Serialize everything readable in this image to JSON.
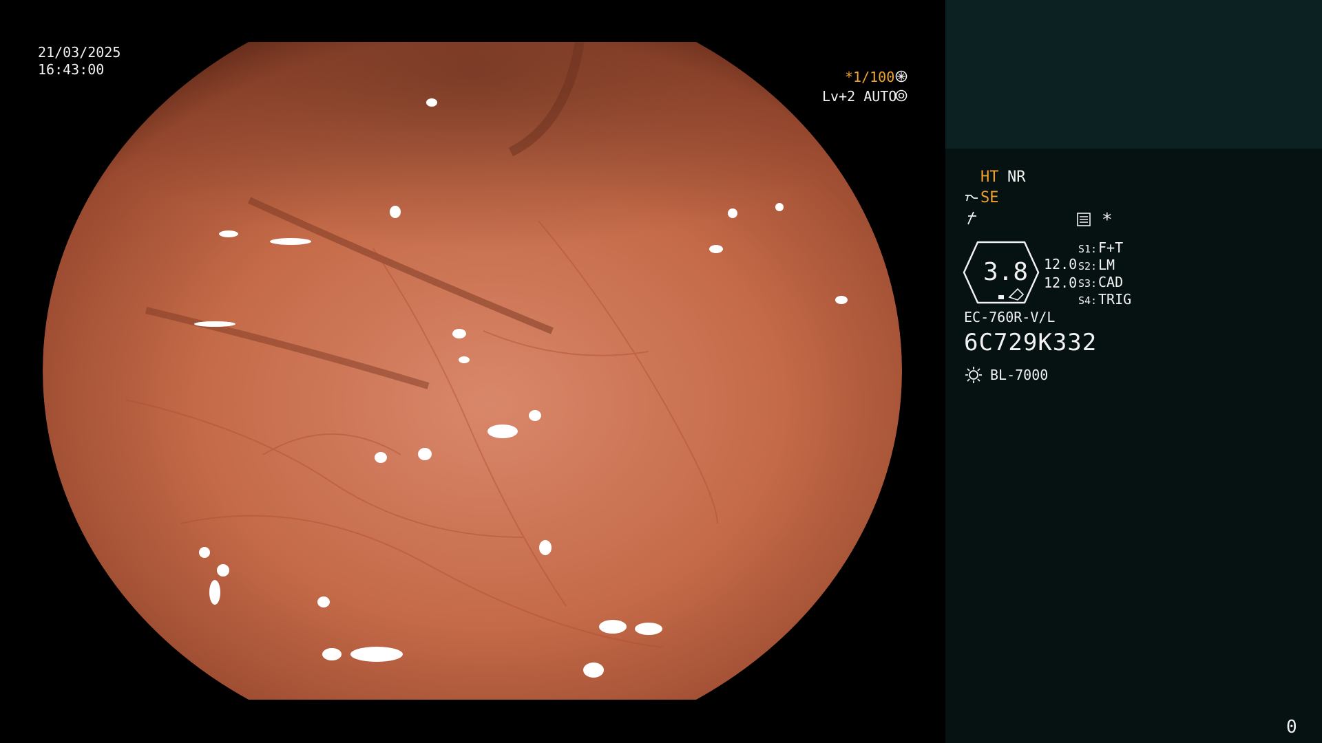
{
  "overlay": {
    "date": "21/03/2025",
    "time": "16:43:00",
    "shutter": "*1/100",
    "shutter_icon": "aperture-icon",
    "level": "Lv+2 AUTO",
    "level_icon": "iris-icon"
  },
  "panel": {
    "ht": "HT",
    "nr": "NR",
    "se": "SE",
    "se_icon": "scope-tip-icon",
    "struct_icon": "freeze-icon",
    "menu_icon": "settings-sheet-icon",
    "asterisk": "*",
    "zoom_value": "3.8",
    "zoom_levels": [
      "12.0",
      "12.0"
    ],
    "switches": [
      {
        "key": "S1:",
        "value": "F+T"
      },
      {
        "key": "S2:",
        "value": "LM"
      },
      {
        "key": "S3:",
        "value": "CAD"
      },
      {
        "key": "S4:",
        "value": "TRIG"
      }
    ],
    "scope_model": "EC-760R-V/L",
    "serial": "6C729K332",
    "light_icon": "light-source-icon",
    "light_source": "BL-7000",
    "counter": "0"
  },
  "colors": {
    "accent": "#f0a22e",
    "panel_top": "#0b2122",
    "panel_main": "#061212",
    "mucosa": "#c8704a"
  }
}
